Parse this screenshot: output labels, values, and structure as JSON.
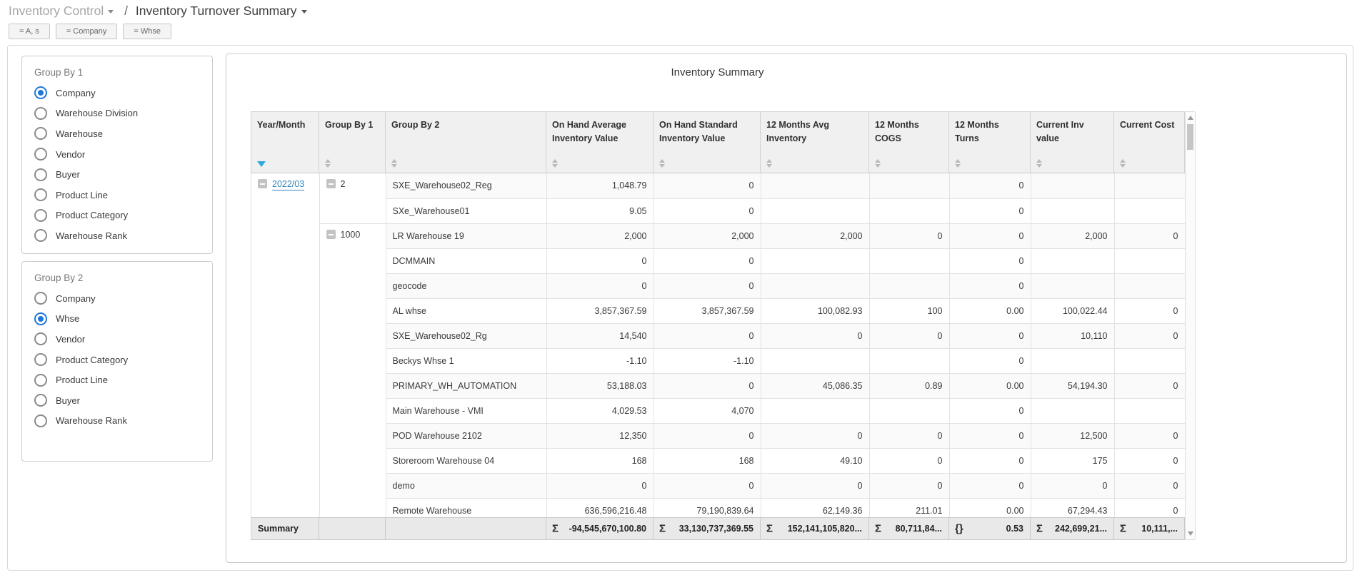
{
  "breadcrumb": {
    "section": "Inventory Control",
    "separator": "/",
    "page": "Inventory Turnover Summary"
  },
  "filters": [
    {
      "label": "= A, s"
    },
    {
      "label": "= Company"
    },
    {
      "label": "= Whse"
    }
  ],
  "colors": {
    "accent_blue": "#2077d8",
    "link_blue": "#3187b8",
    "sort_active_blue": "#2ea9e0"
  },
  "group_by_1": {
    "title": "Group By 1",
    "options": [
      {
        "label": "Company",
        "selected": true
      },
      {
        "label": "Warehouse Division",
        "selected": false
      },
      {
        "label": "Warehouse",
        "selected": false
      },
      {
        "label": "Vendor",
        "selected": false
      },
      {
        "label": "Buyer",
        "selected": false
      },
      {
        "label": "Product Line",
        "selected": false
      },
      {
        "label": "Product Category",
        "selected": false
      },
      {
        "label": "Warehouse Rank",
        "selected": false
      }
    ]
  },
  "group_by_2": {
    "title": "Group By 2",
    "options": [
      {
        "label": "Company",
        "selected": false
      },
      {
        "label": "Whse",
        "selected": true
      },
      {
        "label": "Vendor",
        "selected": false
      },
      {
        "label": "Product Category",
        "selected": false
      },
      {
        "label": "Product Line",
        "selected": false
      },
      {
        "label": "Buyer",
        "selected": false
      },
      {
        "label": "Warehouse Rank",
        "selected": false
      }
    ]
  },
  "table": {
    "title": "Inventory Summary",
    "columns": [
      {
        "label": "Year/Month",
        "sort": "desc"
      },
      {
        "label": "Group By 1",
        "sort": "none"
      },
      {
        "label": "Group By 2",
        "sort": "none"
      },
      {
        "label": "On Hand Average Inventory Value",
        "sort": "none"
      },
      {
        "label": "On Hand Standard Inventory Value",
        "sort": "none"
      },
      {
        "label": "12 Months Avg Inventory",
        "sort": "none"
      },
      {
        "label": "12 Months COGS",
        "sort": "none"
      },
      {
        "label": "12 Months Turns",
        "sort": "none"
      },
      {
        "label": "Current Inv value",
        "sort": "none"
      },
      {
        "label": "Current Cost",
        "sort": "none"
      }
    ],
    "year_month": "2022/03",
    "groups": [
      {
        "group1": "2",
        "rows": [
          {
            "group2": "SXE_Warehouse02_Reg",
            "onhand_avg": "1,048.79",
            "onhand_std": "0",
            "avg12": "",
            "cogs12": "",
            "turns12": "0",
            "cur_inv": "",
            "cur_cost": ""
          },
          {
            "group2": "SXe_Warehouse01",
            "onhand_avg": "9.05",
            "onhand_std": "0",
            "avg12": "",
            "cogs12": "",
            "turns12": "0",
            "cur_inv": "",
            "cur_cost": ""
          }
        ]
      },
      {
        "group1": "1000",
        "rows": [
          {
            "group2": "LR Warehouse 19",
            "onhand_avg": "2,000",
            "onhand_std": "2,000",
            "avg12": "2,000",
            "cogs12": "0",
            "turns12": "0",
            "cur_inv": "2,000",
            "cur_cost": "0"
          },
          {
            "group2": "DCMMAIN",
            "onhand_avg": "0",
            "onhand_std": "0",
            "avg12": "",
            "cogs12": "",
            "turns12": "0",
            "cur_inv": "",
            "cur_cost": ""
          },
          {
            "group2": "geocode",
            "onhand_avg": "0",
            "onhand_std": "0",
            "avg12": "",
            "cogs12": "",
            "turns12": "0",
            "cur_inv": "",
            "cur_cost": ""
          },
          {
            "group2": "AL whse",
            "onhand_avg": "3,857,367.59",
            "onhand_std": "3,857,367.59",
            "avg12": "100,082.93",
            "cogs12": "100",
            "turns12": "0.00",
            "cur_inv": "100,022.44",
            "cur_cost": "0"
          },
          {
            "group2": "SXE_Warehouse02_Rg",
            "onhand_avg": "14,540",
            "onhand_std": "0",
            "avg12": "0",
            "cogs12": "0",
            "turns12": "0",
            "cur_inv": "10,110",
            "cur_cost": "0"
          },
          {
            "group2": "Beckys Whse 1",
            "onhand_avg": "-1.10",
            "onhand_std": "-1.10",
            "avg12": "",
            "cogs12": "",
            "turns12": "0",
            "cur_inv": "",
            "cur_cost": ""
          },
          {
            "group2": "PRIMARY_WH_AUTOMATION",
            "onhand_avg": "53,188.03",
            "onhand_std": "0",
            "avg12": "45,086.35",
            "cogs12": "0.89",
            "turns12": "0.00",
            "cur_inv": "54,194.30",
            "cur_cost": "0"
          },
          {
            "group2": "Main Warehouse - VMI",
            "onhand_avg": "4,029.53",
            "onhand_std": "4,070",
            "avg12": "",
            "cogs12": "",
            "turns12": "0",
            "cur_inv": "",
            "cur_cost": ""
          },
          {
            "group2": "POD Warehouse 2102",
            "onhand_avg": "12,350",
            "onhand_std": "0",
            "avg12": "0",
            "cogs12": "0",
            "turns12": "0",
            "cur_inv": "12,500",
            "cur_cost": "0"
          },
          {
            "group2": "Storeroom Warehouse 04",
            "onhand_avg": "168",
            "onhand_std": "168",
            "avg12": "49.10",
            "cogs12": "0",
            "turns12": "0",
            "cur_inv": "175",
            "cur_cost": "0"
          },
          {
            "group2": "demo",
            "onhand_avg": "0",
            "onhand_std": "0",
            "avg12": "0",
            "cogs12": "0",
            "turns12": "0",
            "cur_inv": "0",
            "cur_cost": "0"
          },
          {
            "group2": "Remote Warehouse",
            "onhand_avg": "636,596,216.48",
            "onhand_std": "79,190,839.64",
            "avg12": "62,149.36",
            "cogs12": "211.01",
            "turns12": "0.00",
            "cur_inv": "67,294.43",
            "cur_cost": "0"
          }
        ]
      }
    ],
    "summary": {
      "label": "Summary",
      "cells": [
        {
          "prefix": "Σ",
          "value": "-94,545,670,100.80"
        },
        {
          "prefix": "Σ",
          "value": "33,130,737,369.55"
        },
        {
          "prefix": "Σ",
          "value": "152,141,105,820..."
        },
        {
          "prefix": "Σ",
          "value": "80,711,84..."
        },
        {
          "prefix": "{}",
          "value": "0.53"
        },
        {
          "prefix": "Σ",
          "value": "242,699,21..."
        },
        {
          "prefix": "Σ",
          "value": "10,111,..."
        }
      ]
    }
  }
}
